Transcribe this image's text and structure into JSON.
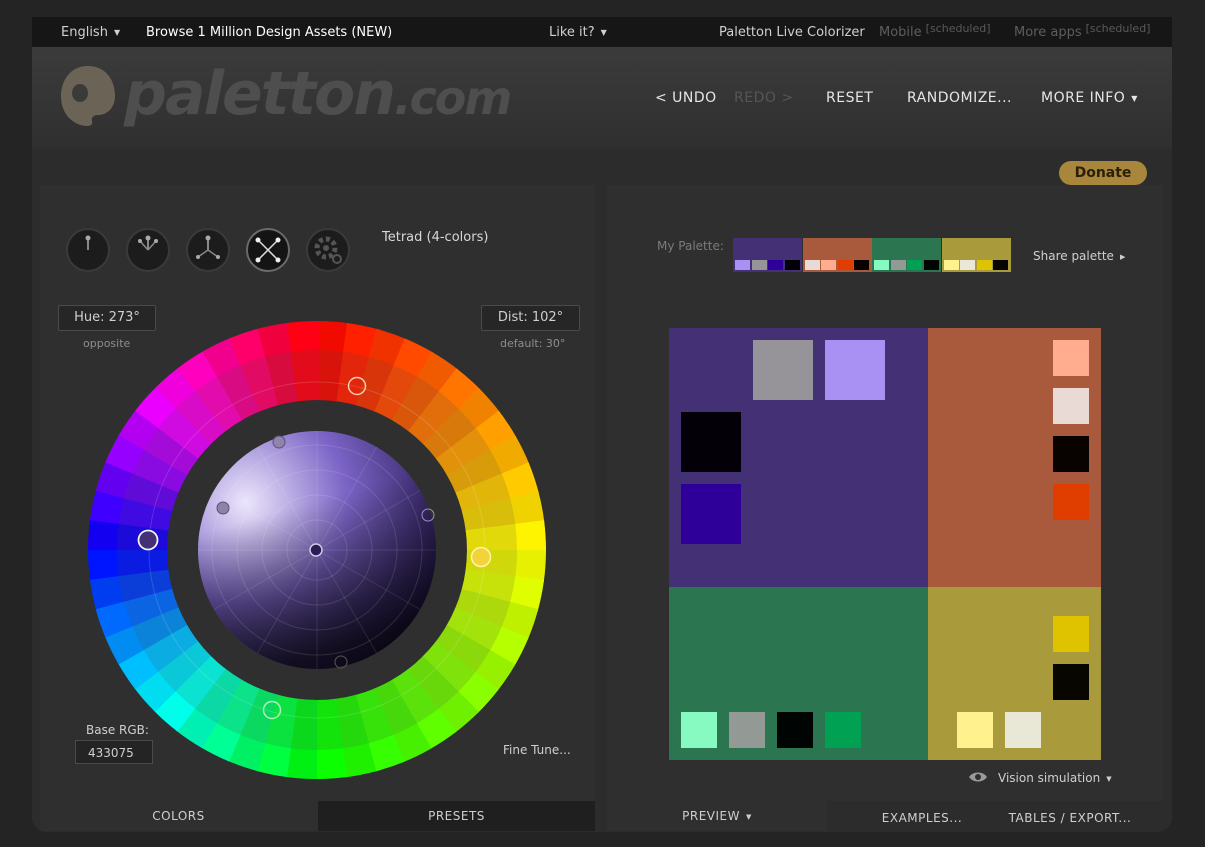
{
  "topbar": {
    "language": "English",
    "assets_link": "Browse 1 Million Design Assets (NEW)",
    "like_it": "Like it?",
    "live_colorizer": "Paletton Live Colorizer",
    "mobile": "Mobile",
    "mobile_tag": "[scheduled]",
    "more_apps": "More apps",
    "more_apps_tag": "[scheduled]"
  },
  "header": {
    "logo_text": "paletton",
    "logo_suffix": ".com",
    "undo": "< UNDO",
    "redo": "REDO >",
    "reset": "RESET",
    "randomize": "RANDOMIZE...",
    "more_info": "MORE INFO"
  },
  "donate": "Donate",
  "scheme": {
    "name": "Tetrad (4-colors)",
    "icons": [
      "mono-scheme-icon",
      "adjacent-scheme-icon",
      "triad-scheme-icon",
      "tetrad-scheme-icon",
      "free-scheme-icon"
    ],
    "active_index": 3
  },
  "wheel": {
    "hue_label": "Hue: 273°",
    "hue_note": "opposite",
    "dist_label": "Dist: 102°",
    "dist_note": "default: 30°",
    "base_rgb_label": "Base RGB:",
    "base_rgb_value": "433075",
    "fine_tune": "Fine Tune...",
    "base_hue_deg": 273,
    "dist_deg": 102
  },
  "left_tabs": {
    "colors": "COLORS",
    "presets": "PRESETS"
  },
  "palette": {
    "label": "My Palette:",
    "share": "Share palette",
    "groups": [
      {
        "main": "#433075",
        "shades": [
          "#a990f3",
          "#979499",
          "#2f0099",
          "#030007"
        ]
      },
      {
        "main": "#a95a3c",
        "shades": [
          "#e9dad6",
          "#ffad8e",
          "#e03e00",
          "#080300"
        ]
      },
      {
        "main": "#2b7650",
        "shades": [
          "#86fac1",
          "#939995",
          "#01a154",
          "#000403"
        ]
      },
      {
        "main": "#a99b3c",
        "shades": [
          "#fff28e",
          "#e9e7d6",
          "#e0c300",
          "#080600"
        ]
      }
    ]
  },
  "preview": {
    "quadrant_colors": [
      "#433075",
      "#a95a3c",
      "#2b7650",
      "#a99b3c"
    ],
    "primary_swatches": [
      "#979499",
      "#a990f3",
      "#030007",
      "#2f0099"
    ],
    "complement_swatches": [
      "#ffad8e",
      "#e9dad6",
      "#080300",
      "#e03e00"
    ],
    "secondary_swatches": [
      "#86fac1",
      "#939995",
      "#000403",
      "#01a154"
    ],
    "tertiary_swatches": [
      "#e0c300",
      "#080600",
      "#fff28e",
      "#e9e7d6"
    ],
    "vision": "Vision simulation"
  },
  "right_tabs": {
    "preview": "PREVIEW",
    "examples": "EXAMPLES...",
    "tables": "TABLES / EXPORT..."
  }
}
